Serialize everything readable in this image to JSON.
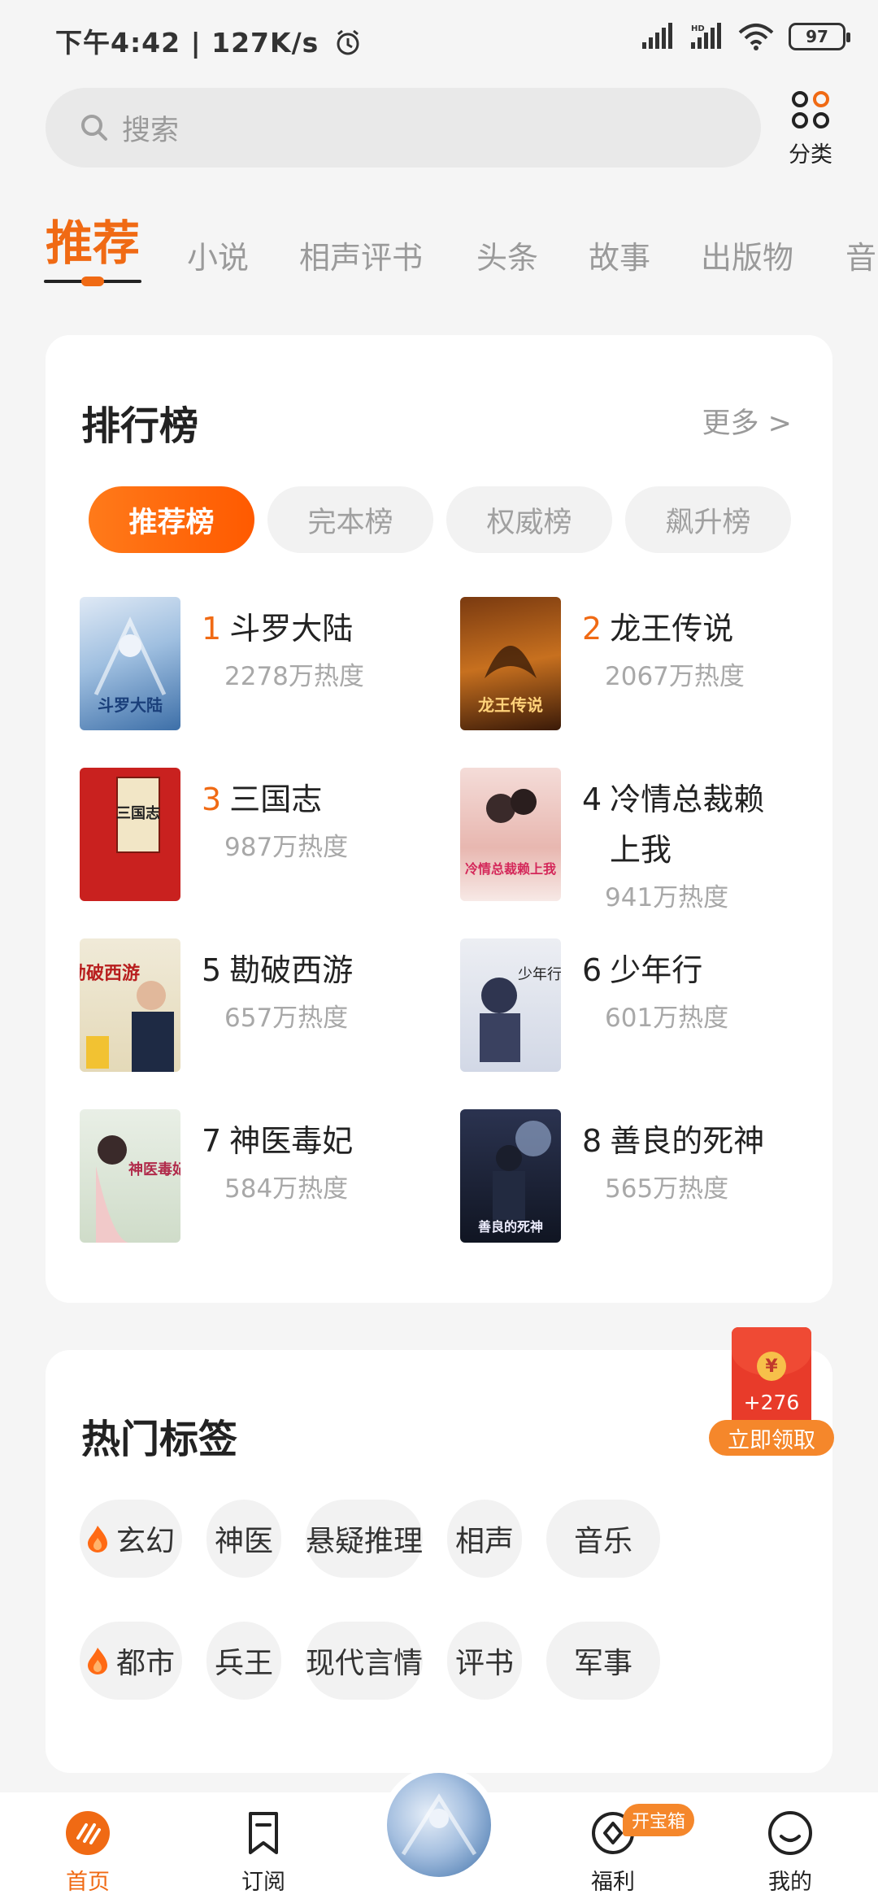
{
  "status_bar": {
    "time": "下午4:42 | 127K/s",
    "battery": "97"
  },
  "search": {
    "placeholder": "搜索"
  },
  "category": {
    "label": "分类"
  },
  "tabs": {
    "active": "推荐",
    "items": [
      "小说",
      "相声评书",
      "头条",
      "故事",
      "出版物",
      "音"
    ]
  },
  "ranking": {
    "title": "排行榜",
    "more": "更多 >",
    "pills": [
      "推荐榜",
      "完本榜",
      "权威榜",
      "飙升榜"
    ],
    "books": [
      {
        "rank": "1",
        "title": "斗罗大陆",
        "heat": "2278万热度",
        "cover_text": "斗罗大陆"
      },
      {
        "rank": "2",
        "title": "龙王传说",
        "heat": "2067万热度",
        "cover_text": "龙王传说"
      },
      {
        "rank": "3",
        "title": "三国志",
        "heat": "987万热度",
        "cover_text": "三国志"
      },
      {
        "rank": "4",
        "title": "冷情总裁赖",
        "title2": "上我",
        "heat": "941万热度",
        "cover_text": "冷情总裁赖上我"
      },
      {
        "rank": "5",
        "title": "勘破西游",
        "heat": "657万热度",
        "cover_text": "勘破西游"
      },
      {
        "rank": "6",
        "title": "少年行",
        "heat": "601万热度",
        "cover_text": "少年行"
      },
      {
        "rank": "7",
        "title": "神医毒妃",
        "heat": "584万热度",
        "cover_text": "神医毒妃"
      },
      {
        "rank": "8",
        "title": "善良的死神",
        "heat": "565万热度",
        "cover_text": "善良的死神"
      }
    ]
  },
  "hot_tags": {
    "title": "热门标签",
    "row1": [
      "玄幻",
      "神医",
      "悬疑推理",
      "相声",
      "音乐"
    ],
    "row2": [
      "都市",
      "兵王",
      "现代言情",
      "评书",
      "军事"
    ]
  },
  "red_envelope": {
    "amount": "+276",
    "claim": "立即领取"
  },
  "bottom_nav": {
    "home": "首页",
    "subscribe": "订阅",
    "welfare": "福利",
    "welfare_badge": "开宝箱",
    "mine": "我的"
  },
  "colors": {
    "accent": "#f06a14",
    "muted": "#9a9a9a"
  }
}
